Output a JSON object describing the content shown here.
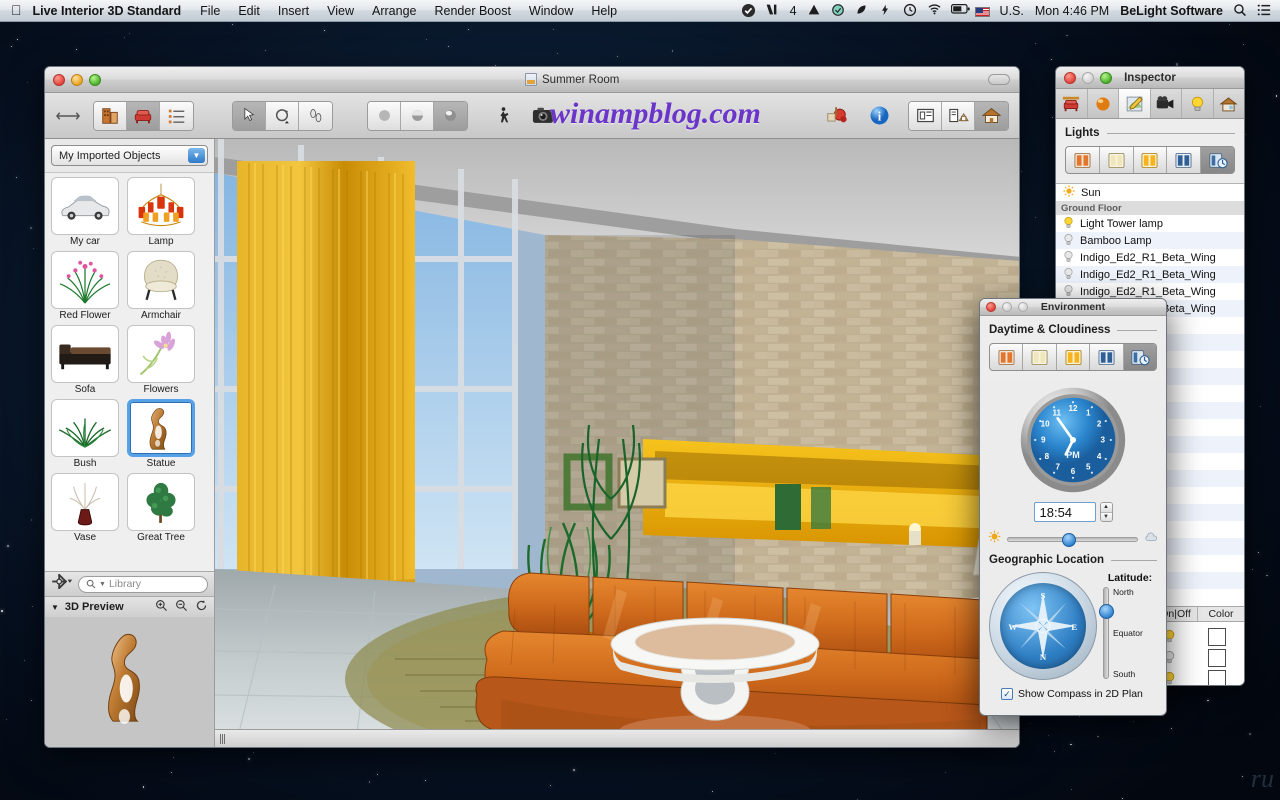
{
  "menubar": {
    "apple_icon": "apple-icon",
    "app_name": "Live Interior 3D Standard",
    "menus": [
      "File",
      "Edit",
      "Insert",
      "View",
      "Arrange",
      "Render Boost",
      "Window",
      "Help"
    ],
    "status_icons": [
      "checkmark-circle-icon",
      "adobe-icon",
      "google-drive-icon",
      "dropbox-icon",
      "evernote-icon",
      "flash-icon",
      "time-machine-icon",
      "wifi-icon",
      "battery-icon"
    ],
    "adobe_badge": "4",
    "input_source": "U.S.",
    "clock": "Mon 4:46 PM",
    "user": "BeLight Software",
    "spotlight_icon": "search-icon",
    "notification_icon": "list-icon"
  },
  "main_window": {
    "title": "Summer Room",
    "watermark": "winampblog.com",
    "toolbar": {
      "resize_icon": "arrows-horizontal-icon",
      "view_group": [
        {
          "name": "building-view-button",
          "icon": "building-icon",
          "active": false
        },
        {
          "name": "furniture-view-button",
          "icon": "furniture-icon",
          "active": true
        },
        {
          "name": "list-view-button",
          "icon": "list-icon",
          "active": false
        }
      ],
      "tool_group": [
        {
          "name": "select-tool-button",
          "icon": "cursor-icon",
          "active": true
        },
        {
          "name": "rotate-tool-button",
          "icon": "rotate-icon",
          "active": false
        },
        {
          "name": "walk-tool-button",
          "icon": "footsteps-icon",
          "active": false
        }
      ],
      "render_group": [
        {
          "name": "flat-render-button",
          "icon": "sphere-flat-icon",
          "active": false
        },
        {
          "name": "shaded-render-button",
          "icon": "sphere-shaded-icon",
          "active": false
        },
        {
          "name": "glossy-render-button",
          "icon": "sphere-glossy-icon",
          "active": true
        }
      ],
      "walk_button": "walk-person-icon",
      "camera_button": "camera-icon",
      "render_boost_button": "render-boost-icon",
      "info_button": "info-icon",
      "layout_group": [
        {
          "name": "plan-view-button",
          "icon": "plan-icon",
          "active": false
        },
        {
          "name": "split-view-button",
          "icon": "split-view-icon",
          "active": false
        },
        {
          "name": "3d-view-button",
          "icon": "house-icon",
          "active": true
        }
      ]
    },
    "sidebar": {
      "category_popup": "My Imported Objects",
      "objects": [
        {
          "label": "My car",
          "icon": "car-thumb",
          "selected": false
        },
        {
          "label": "Lamp",
          "icon": "chandelier-thumb",
          "selected": false
        },
        {
          "label": "Red Flower",
          "icon": "red-flower-thumb",
          "selected": false
        },
        {
          "label": "Armchair",
          "icon": "armchair-thumb",
          "selected": false
        },
        {
          "label": "Sofa",
          "icon": "sofa-thumb",
          "selected": false
        },
        {
          "label": "Flowers",
          "icon": "flowers-thumb",
          "selected": false
        },
        {
          "label": "Bush",
          "icon": "bush-thumb",
          "selected": false
        },
        {
          "label": "Statue",
          "icon": "statue-thumb",
          "selected": true
        },
        {
          "label": "Vase",
          "icon": "vase-thumb",
          "selected": false
        },
        {
          "label": "Great Tree",
          "icon": "great-tree-thumb",
          "selected": false
        }
      ],
      "gear_menu": "gear-icon",
      "search_placeholder": "Library",
      "preview_title": "3D Preview",
      "preview_buttons": [
        "zoom-in-icon",
        "zoom-out-icon",
        "reset-icon"
      ]
    }
  },
  "inspector": {
    "title": "Inspector",
    "tabs": [
      {
        "name": "object-tab",
        "icon": "furniture-icon",
        "active": false
      },
      {
        "name": "material-tab",
        "icon": "sphere-icon",
        "active": false
      },
      {
        "name": "edit-tab",
        "icon": "pencil-icon",
        "active": true
      },
      {
        "name": "camera-tab",
        "icon": "camera-icon",
        "active": false
      },
      {
        "name": "light-tab",
        "icon": "lightbulb-icon",
        "active": false
      },
      {
        "name": "house-tab",
        "icon": "house-icon",
        "active": false
      }
    ],
    "section_title": "Lights",
    "preset_buttons": [
      {
        "name": "preset-dawn",
        "active": false
      },
      {
        "name": "preset-day",
        "active": false
      },
      {
        "name": "preset-evening",
        "active": false
      },
      {
        "name": "preset-night",
        "active": false
      },
      {
        "name": "preset-custom-time",
        "active": true
      }
    ],
    "lights": [
      {
        "label": "Sun",
        "icon": "sun-icon",
        "type": "item"
      },
      {
        "label": "Ground Floor",
        "type": "group"
      },
      {
        "label": "Light Tower lamp",
        "icon": "bulb-on-icon",
        "type": "item"
      },
      {
        "label": "Bamboo Lamp",
        "icon": "bulb-off-icon",
        "type": "item"
      },
      {
        "label": "Indigo_Ed2_R1_Beta_Wing",
        "icon": "bulb-off-icon",
        "type": "item"
      },
      {
        "label": "Indigo_Ed2_R1_Beta_Wing",
        "icon": "bulb-off-icon",
        "type": "item"
      },
      {
        "label": "Indigo_Ed2_R1_Beta_Wing",
        "icon": "bulb-off-icon",
        "type": "item"
      },
      {
        "label": "Indigo_Ed2_R1_Beta_Wing",
        "icon": "bulb-off-icon",
        "type": "item"
      }
    ],
    "columns": [
      "On|Off",
      "Color"
    ],
    "color_rows": [
      {
        "bulb": "bulb-on-icon",
        "color": "#ffffff"
      },
      {
        "bulb": "bulb-off-icon",
        "color": "#ffffff"
      },
      {
        "bulb": "bulb-on-icon",
        "color": "#ffffff"
      }
    ]
  },
  "environment": {
    "title": "Environment",
    "daytime_section": "Daytime & Cloudiness",
    "preset_buttons": [
      {
        "name": "preset-dawn",
        "active": false
      },
      {
        "name": "preset-day",
        "active": false
      },
      {
        "name": "preset-evening",
        "active": false
      },
      {
        "name": "preset-night",
        "active": false
      },
      {
        "name": "preset-custom-time",
        "active": true
      }
    ],
    "clock_label": "PM",
    "clock_numbers": [
      "12",
      "1",
      "2",
      "3",
      "4",
      "5",
      "6",
      "7",
      "8",
      "9",
      "10",
      "11"
    ],
    "time_value": "18:54",
    "cloudiness": {
      "left_icon": "sun-icon",
      "right_icon": "cloud-icon",
      "value_pct": 42
    },
    "geo_section": "Geographic Location",
    "compass_points": [
      "N",
      "E",
      "S",
      "W"
    ],
    "latitude_label": "Latitude:",
    "latitude_ticks": [
      "North",
      "Equator",
      "South"
    ],
    "latitude_pct": 22,
    "checkbox_label": "Show Compass in 2D Plan",
    "checkbox_checked": true
  },
  "colors": {
    "accent_blue": "#2f7fc4",
    "selection_blue": "#56a2e8",
    "watermark_purple": "#6a35c8",
    "orange_sofa": "#d4701f",
    "curtain_yellow": "#e8a911"
  }
}
